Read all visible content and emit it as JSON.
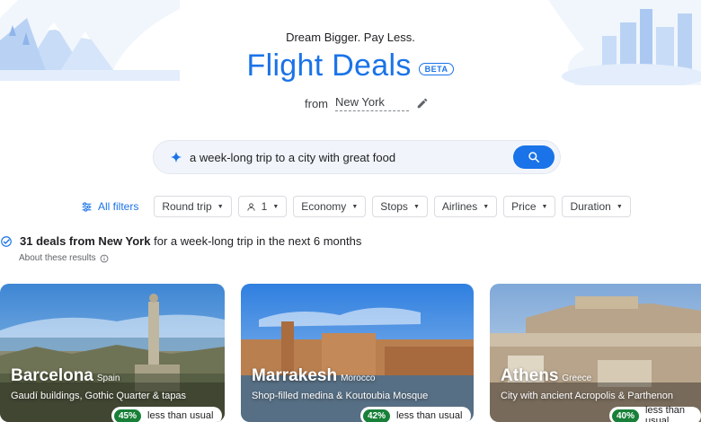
{
  "header": {
    "tagline": "Dream Bigger. Pay Less.",
    "title": "Flight Deals",
    "badge": "BETA",
    "from_label": "from",
    "origin": "New York",
    "edit_icon": "pencil-icon"
  },
  "search": {
    "query": "a week-long trip to a city with great food",
    "sparkle_icon": "sparkle-icon",
    "button_icon": "search-icon"
  },
  "filters": {
    "all_filters": "All filters",
    "chips": {
      "trip_type": "Round trip",
      "passengers": "1",
      "cabin": "Economy",
      "stops": "Stops",
      "airlines": "Airlines",
      "price": "Price",
      "duration": "Duration"
    }
  },
  "results": {
    "count_text": "31 deals from New York",
    "rest_text": " for a week-long trip in the next 6 months",
    "about": "About these results"
  },
  "cards": [
    {
      "city": "Barcelona",
      "country": "Spain",
      "desc": "Gaudí buildings, Gothic Quarter & tapas",
      "pct": "45%",
      "deal": "less than usual"
    },
    {
      "city": "Marrakesh",
      "country": "Morocco",
      "desc": "Shop-filled medina & Koutoubia Mosque",
      "pct": "42%",
      "deal": "less than usual"
    },
    {
      "city": "Athens",
      "country": "Greece",
      "desc": "City with ancient Acropolis & Parthenon",
      "pct": "40%",
      "deal": "less than usual"
    }
  ],
  "colors": {
    "accent": "#1a73e8",
    "deal_badge": "#188038"
  }
}
